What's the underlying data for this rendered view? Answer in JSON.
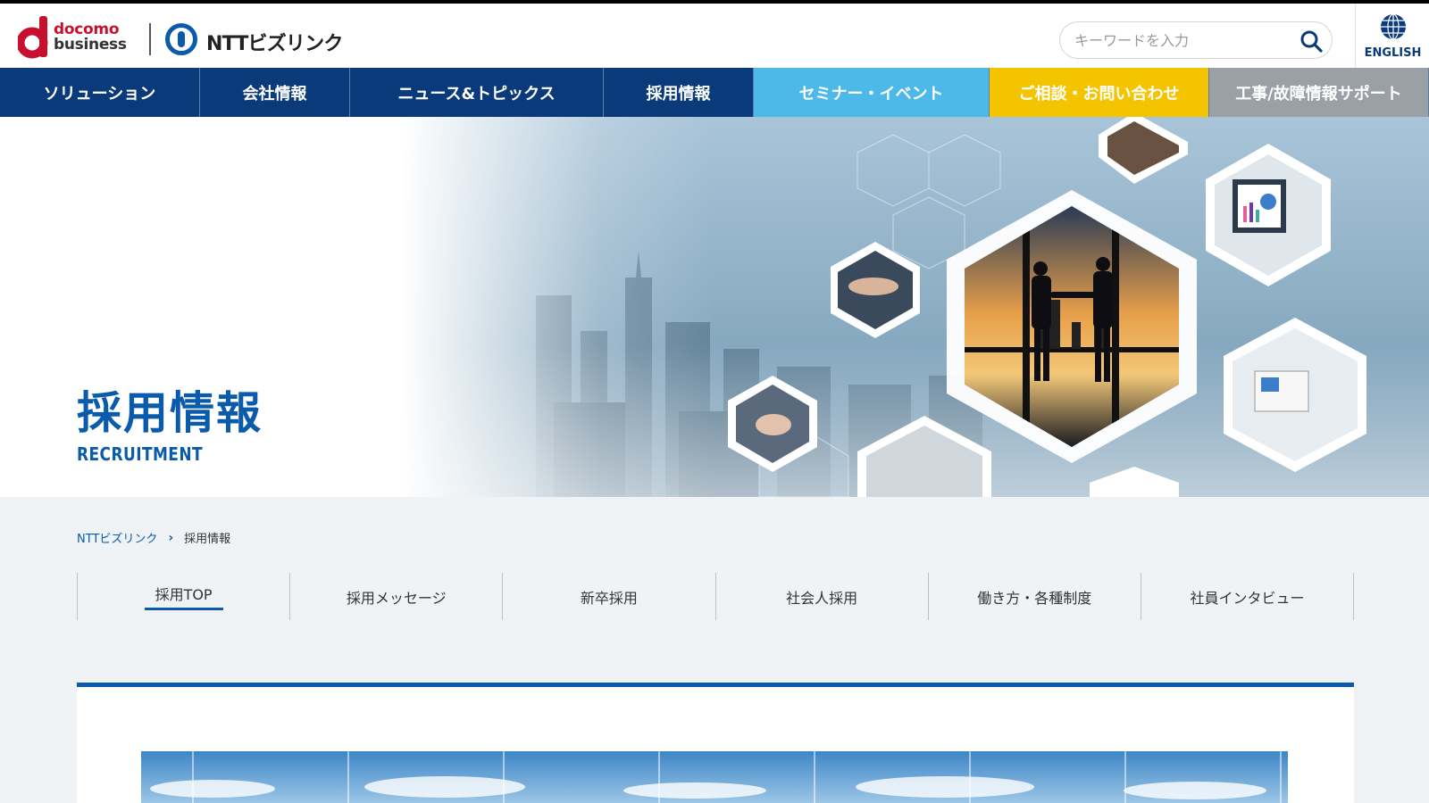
{
  "header": {
    "docomo_line1": "docomo",
    "docomo_line2": "business",
    "ntt_logo": "NTTビズリンク",
    "search_placeholder": "キーワードを入力",
    "english_label": "ENGLISH"
  },
  "nav": {
    "items": [
      {
        "label": "ソリューション",
        "bg": "#0a3a7a"
      },
      {
        "label": "会社情報",
        "bg": "#0a3a7a"
      },
      {
        "label": "ニュース&トピックス",
        "bg": "#0a3a7a"
      },
      {
        "label": "採用情報",
        "bg": "#0a3a7a"
      },
      {
        "label": "セミナー・イベント",
        "bg": "#4db8ea"
      },
      {
        "label": "ご相談・お問い合わせ",
        "bg": "#f5c400"
      },
      {
        "label": "工事/故障情報サポート",
        "bg": "#9aa0a6"
      }
    ]
  },
  "hero": {
    "title": "採用情報",
    "subtitle": "RECRUITMENT"
  },
  "breadcrumb": {
    "home": "NTTビズリンク",
    "current": "採用情報"
  },
  "subnav": {
    "tabs": [
      "採用TOP",
      "採用メッセージ",
      "新卒採用",
      "社会人採用",
      "働き方・各種制度",
      "社員インタビュー"
    ],
    "active_index": 0
  },
  "colors": {
    "primary": "#0a5bab",
    "nav_dark": "#0a3a7a",
    "content_bg": "#eff3f5"
  }
}
